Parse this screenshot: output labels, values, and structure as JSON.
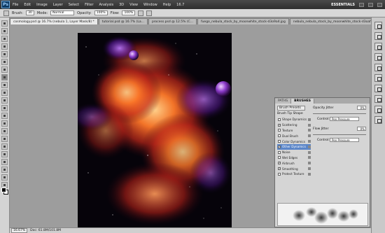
{
  "app": {
    "logo_text": "Ps"
  },
  "menu": [
    "File",
    "Edit",
    "Image",
    "Layer",
    "Select",
    "Filter",
    "Analysis",
    "3D",
    "View",
    "Window",
    "Help"
  ],
  "zoom_menu": "16.7",
  "workspace": "ESSENTIALS",
  "options": {
    "brush_label": "Brush:",
    "brush_size": "30",
    "mode_label": "Mode:",
    "mode_value": "Normal",
    "opacity_label": "Opacity:",
    "opacity_value": "100%",
    "flow_label": "Flow:",
    "flow_value": "100%"
  },
  "tabs": [
    "cosmology.psd @ 16.7% (nebula 1, Layer Mask/8) *",
    "tutorial.psd @ 16.7% (La...",
    "process.psd @ 12.5% (C...",
    "fuego_nebula_stock_by_moonwhite_stock-d3o9a4.jpg",
    "nebula_nebula_stock_by_moonwhite_stock-d3oaf4.jpg"
  ],
  "status": {
    "zoom": "16.67%",
    "doc": "Doc: 61.8M/101.8M"
  },
  "panel": {
    "tab_paths": "PATHS",
    "tab_brushes": "BRUSHES",
    "presets_button": "Brush Presets",
    "tip_shape": "Brush Tip Shape",
    "options": [
      {
        "label": "Shape Dynamics",
        "checked": false
      },
      {
        "label": "Scattering",
        "checked": true
      },
      {
        "label": "Texture",
        "checked": false
      },
      {
        "label": "Dual Brush",
        "checked": false
      },
      {
        "label": "Color Dynamics",
        "checked": false
      },
      {
        "label": "Other Dynamics",
        "checked": true,
        "selected": true
      },
      {
        "label": "Noise",
        "checked": false
      },
      {
        "label": "Wet Edges",
        "checked": false
      },
      {
        "label": "Airbrush",
        "checked": true
      },
      {
        "label": "Smoothing",
        "checked": true
      },
      {
        "label": "Protect Texture",
        "checked": false
      }
    ],
    "opacity_jitter_label": "Opacity Jitter",
    "opacity_jitter_value": "0%",
    "control_label": "Control:",
    "control_value": "Pen Pressure",
    "flow_jitter_label": "Flow Jitter",
    "flow_jitter_value": "0%",
    "control2_label": "Control:",
    "control2_value": "Pen Pressure"
  },
  "colors": {
    "foreground": "#000000",
    "background": "#ffffff",
    "selection": "#5b86c9"
  }
}
